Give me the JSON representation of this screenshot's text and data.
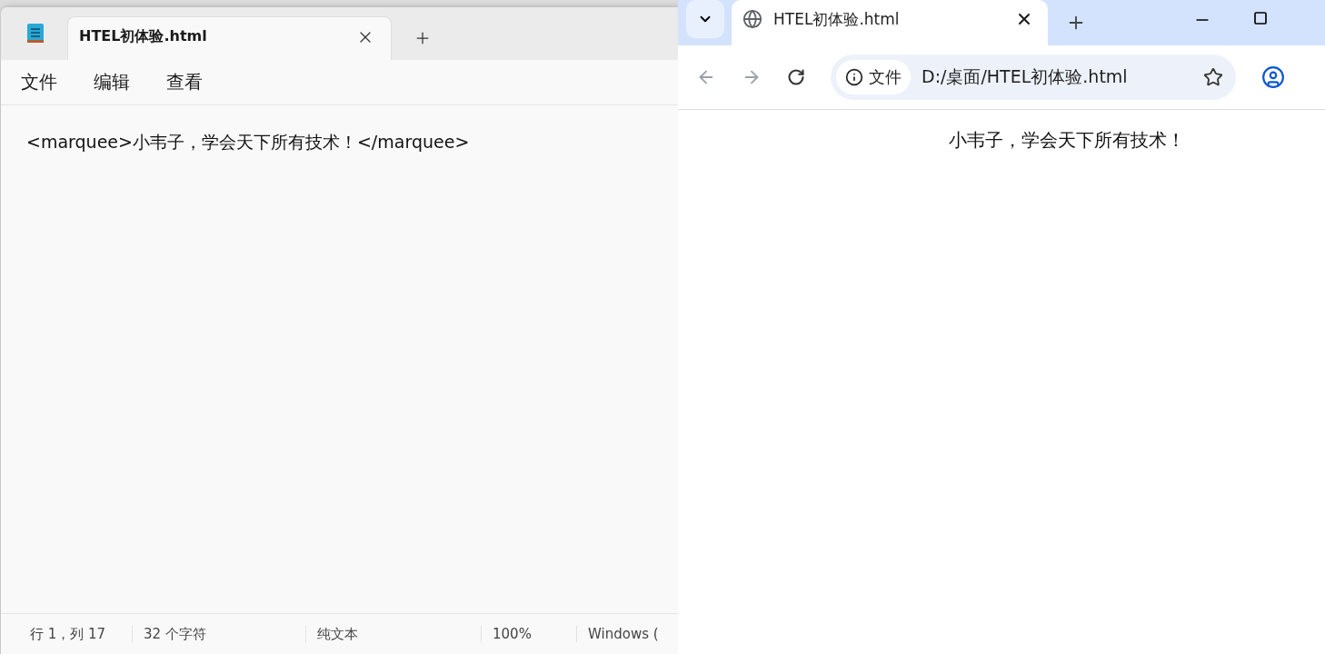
{
  "notepad": {
    "tab": {
      "title": "HTEL初体验.html",
      "selected": true
    },
    "menu": [
      "文件",
      "编辑",
      "查看"
    ],
    "content": "<marquee>小韦子，学会天下所有技术！</marquee>",
    "status_bar": [
      "行 1，列 17",
      "32 个字符",
      "纯文本",
      "100%",
      "Windows ("
    ]
  },
  "browser": {
    "tab": {
      "title": "HTEL初体验.html",
      "selected": true
    },
    "address": {
      "badge": "文件",
      "url": "D:/桌面/HTEL初体验.html"
    },
    "page_text": "小韦子，学会天下所有技术！"
  }
}
